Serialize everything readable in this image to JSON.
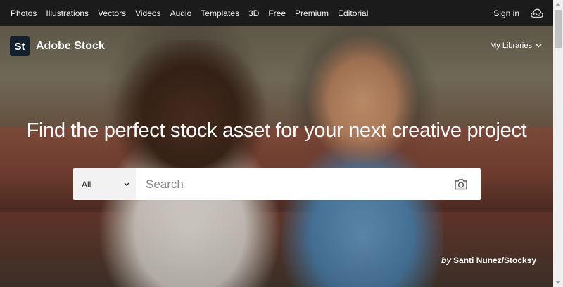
{
  "nav": {
    "items": [
      "Photos",
      "Illustrations",
      "Vectors",
      "Videos",
      "Audio",
      "Templates",
      "3D",
      "Free",
      "Premium",
      "Editorial"
    ],
    "sign_in": "Sign in",
    "cc_icon": "creative-cloud-icon"
  },
  "brand": {
    "logo_text": "St",
    "name": "Adobe Stock",
    "logo_color": "#13212e"
  },
  "libraries": {
    "label": "My Libraries"
  },
  "hero": {
    "headline": "Find the perfect stock asset for your next creative project",
    "credit_prefix": "by",
    "credit_name": "Santi Nunez/Stocksy"
  },
  "search": {
    "category": "All",
    "placeholder": "Search",
    "camera_icon": "camera-icon"
  },
  "colors": {
    "topbar": "#1b1b1b",
    "text": "#ffffff"
  }
}
